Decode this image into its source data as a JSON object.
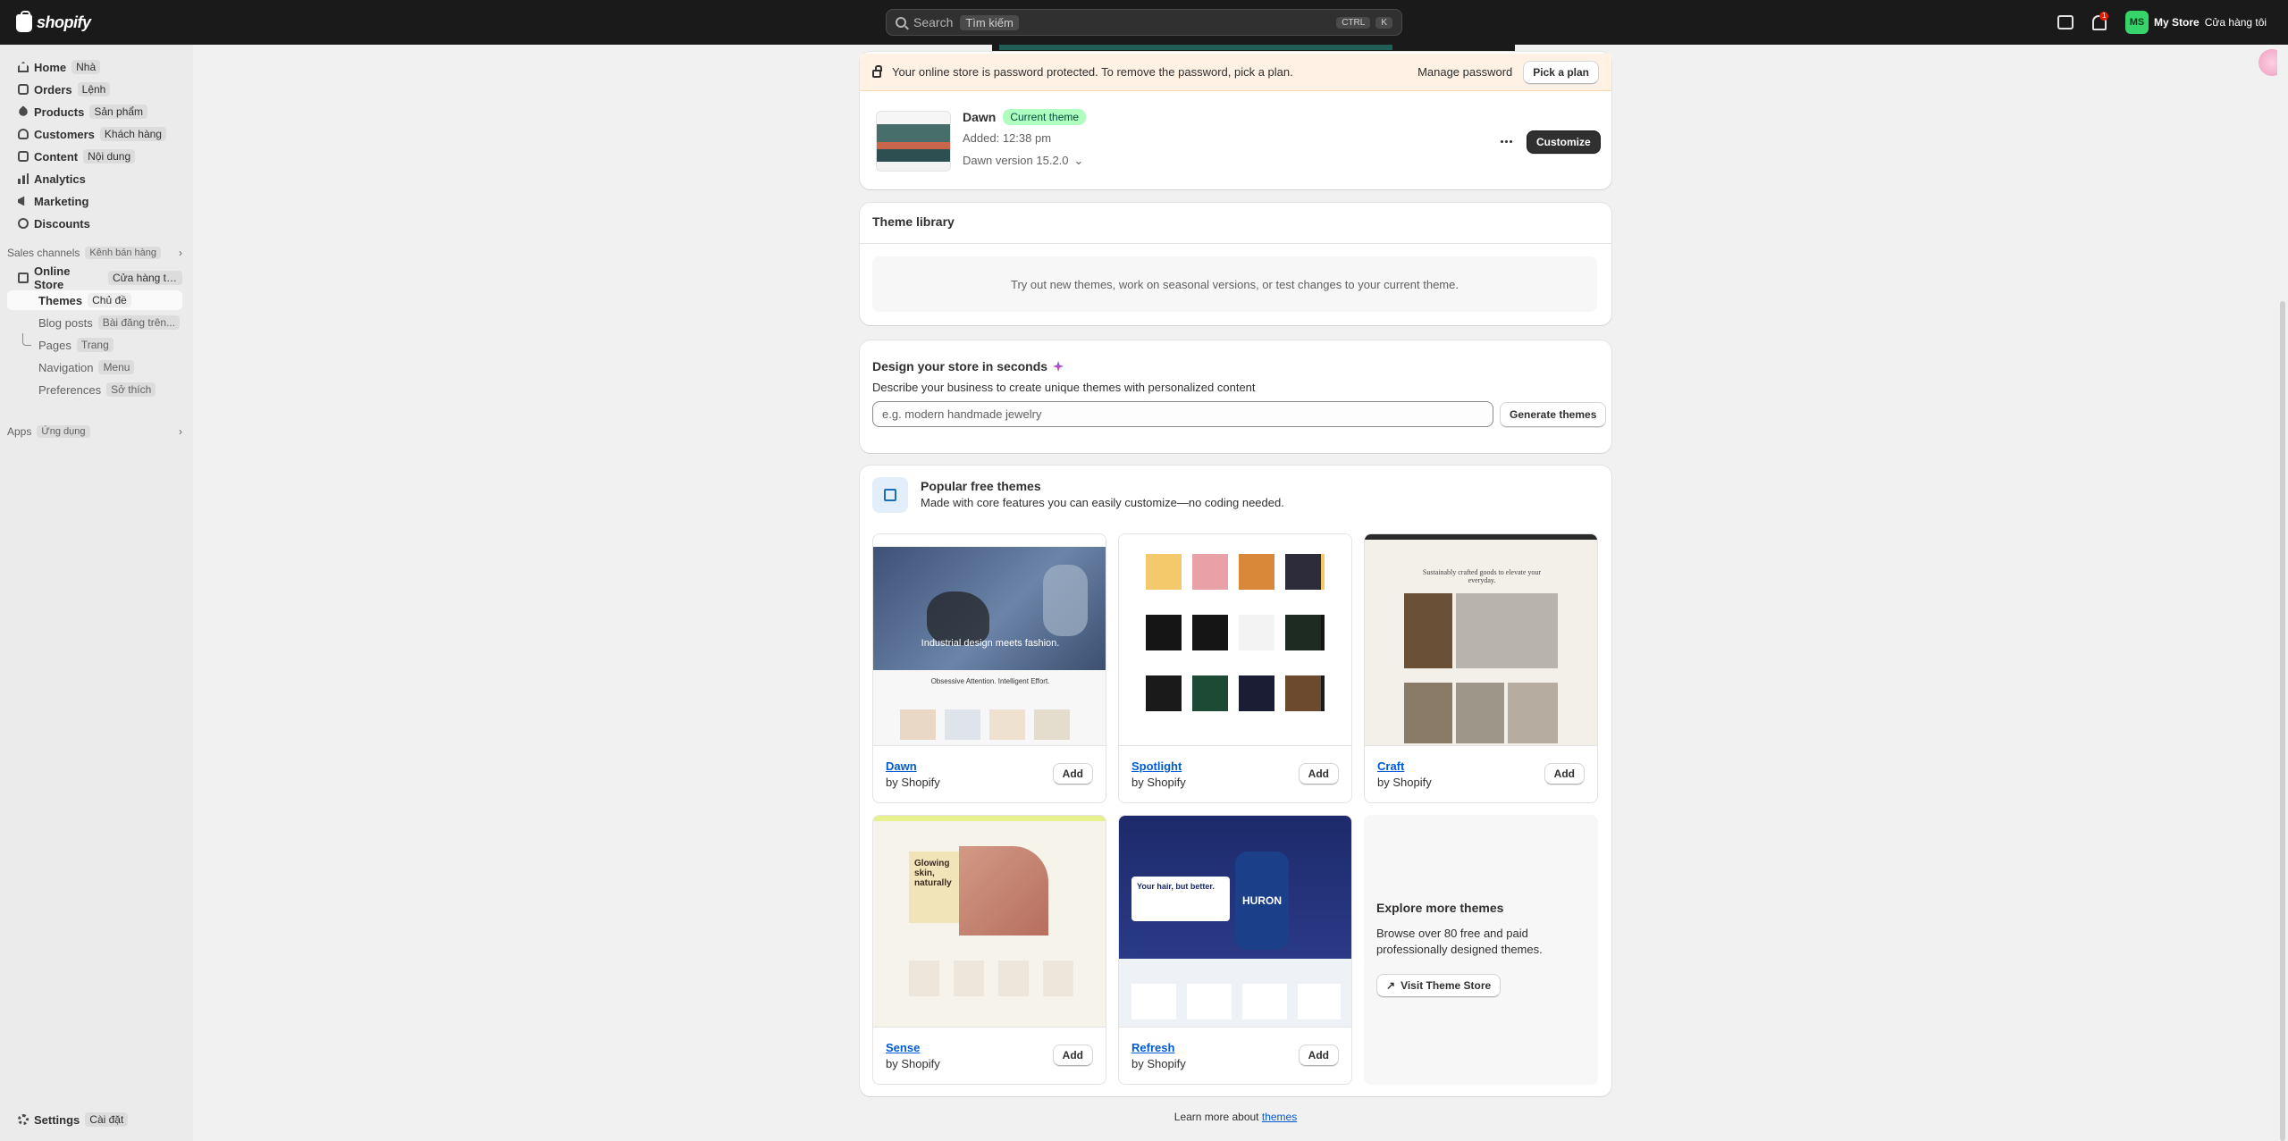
{
  "topbar": {
    "logo": "shopify",
    "search_placeholder": "Search",
    "search_vi": "Tìm kiếm",
    "kbd_ctrl": "CTRL",
    "kbd_k": "K",
    "notif_count": "1",
    "avatar": "MS",
    "store_name": "My Store",
    "store_vi": "Cửa hàng tôi"
  },
  "sidebar": {
    "items": [
      {
        "label": "Home",
        "vi": "Nhà"
      },
      {
        "label": "Orders",
        "vi": "Lệnh"
      },
      {
        "label": "Products",
        "vi": "Sản phẩm"
      },
      {
        "label": "Customers",
        "vi": "Khách hàng"
      },
      {
        "label": "Content",
        "vi": "Nội dung"
      },
      {
        "label": "Analytics",
        "vi": ""
      },
      {
        "label": "Marketing",
        "vi": ""
      },
      {
        "label": "Discounts",
        "vi": ""
      }
    ],
    "sales_channels": {
      "label": "Sales channels",
      "vi": "Kênh bán hàng"
    },
    "online_store": {
      "label": "Online Store",
      "vi": "Cửa hàng tr..."
    },
    "sub": [
      {
        "label": "Themes",
        "vi": "Chủ đề"
      },
      {
        "label": "Blog posts",
        "vi": "Bài đăng trên..."
      },
      {
        "label": "Pages",
        "vi": "Trang"
      },
      {
        "label": "Navigation",
        "vi": "Menu"
      },
      {
        "label": "Preferences",
        "vi": "Sở thích"
      }
    ],
    "apps": {
      "label": "Apps",
      "vi": "Ứng dụng"
    },
    "settings": {
      "label": "Settings",
      "vi": "Cài đặt"
    }
  },
  "banner": {
    "text": "Your online store is password protected. To remove the password, pick a plan.",
    "manage": "Manage password",
    "pick": "Pick a plan"
  },
  "current": {
    "name": "Dawn",
    "badge": "Current theme",
    "added": "Added: 12:38 pm",
    "version": "Dawn version 15.2.0",
    "customize": "Customize"
  },
  "library": {
    "title": "Theme library",
    "empty": "Try out new themes, work on seasonal versions, or test changes to your current theme."
  },
  "design": {
    "title": "Design your store in seconds",
    "desc": "Describe your business to create unique themes with personalized content",
    "placeholder": "e.g. modern handmade jewelry",
    "button": "Generate themes"
  },
  "popular": {
    "title": "Popular free themes",
    "desc": "Made with core features you can easily customize—no coding needed.",
    "themes": [
      {
        "name": "Dawn",
        "by": "by Shopify",
        "add": "Add",
        "hero": "Industrial design meets fashion.",
        "sub": "Obsessive Attention. Intelligent Effort."
      },
      {
        "name": "Spotlight",
        "by": "by Shopify",
        "add": "Add"
      },
      {
        "name": "Craft",
        "by": "by Shopify",
        "add": "Add",
        "hero": "Sustainably crafted goods to elevate your everyday."
      },
      {
        "name": "Sense",
        "by": "by Shopify",
        "add": "Add",
        "hero": "Glowing skin, naturally"
      },
      {
        "name": "Refresh",
        "by": "by Shopify",
        "add": "Add",
        "hero": "Your hair, but better.",
        "brand": "HURON"
      }
    ],
    "explore": {
      "title": "Explore more themes",
      "desc": "Browse over 80 free and paid professionally designed themes.",
      "button": "Visit Theme Store"
    }
  },
  "learn": {
    "text": "Learn more about",
    "link": "themes"
  }
}
